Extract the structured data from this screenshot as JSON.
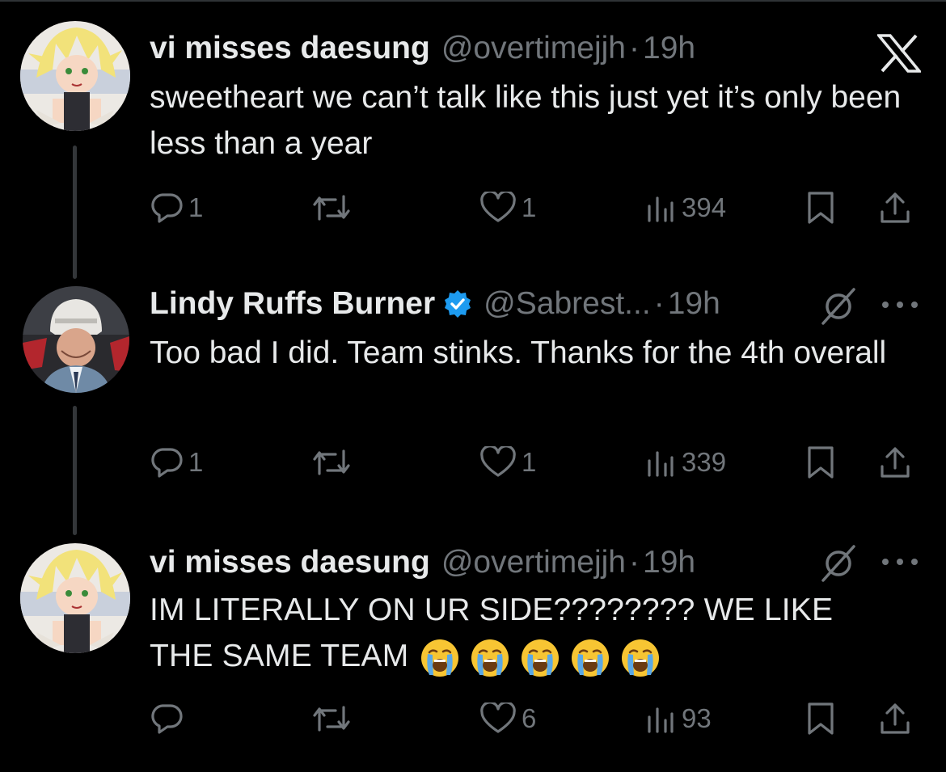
{
  "tweets": [
    {
      "name": "vi misses daesung",
      "handle": "@overtimejjh",
      "sep": "·",
      "time": "19h",
      "text": "sweetheart we can’t talk like this just yet it’s only been less than a year",
      "reply_count": "1",
      "like_count": "1",
      "views": "394",
      "verified": false,
      "avatar_icon": "anime-avatar-icon"
    },
    {
      "name": "Lindy Ruffs Burner",
      "handle": "@Sabrest...",
      "sep": "·",
      "time": "19h",
      "text": "Too bad I did. Team stinks. Thanks for the 4th overall",
      "reply_count": "1",
      "like_count": "1",
      "views": "339",
      "verified": true,
      "avatar_icon": "hockey-helmet-avatar-icon"
    },
    {
      "name": "vi misses daesung",
      "handle": "@overtimejjh",
      "sep": "·",
      "time": "19h",
      "text": "IM LITERALLY ON UR SIDE???????? WE LIKE THE SAME TEAM",
      "reply_count": "",
      "like_count": "6",
      "views": "93",
      "verified": false,
      "emoji_count": 5,
      "emoji_icon": "loudly-crying-face-icon",
      "avatar_icon": "anime-avatar-icon"
    }
  ],
  "icons": {
    "close": "x-logo-icon",
    "more": "more-dots-icon",
    "grok": "grok-icon",
    "reply": "reply-icon",
    "retweet": "retweet-icon",
    "like": "like-icon",
    "views": "views-icon",
    "bookmark": "bookmark-icon",
    "share": "share-icon"
  },
  "colors": {
    "background": "#000000",
    "text": "#e7e9ea",
    "secondary": "#71767b",
    "verified": "#1d9bf0"
  }
}
